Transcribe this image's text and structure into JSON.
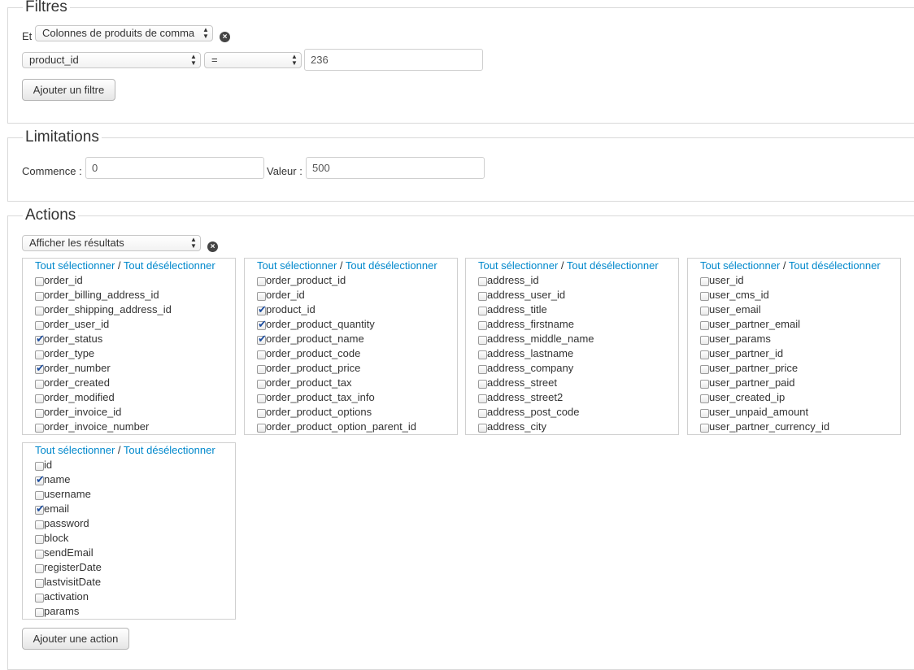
{
  "filters": {
    "legend": "Filtres",
    "and_label": "Et",
    "column_select": "Colonnes de produits de comma",
    "field_select": "product_id",
    "operator_select": "=",
    "value": "236",
    "add_button": "Ajouter un filtre"
  },
  "limits": {
    "legend": "Limitations",
    "start_label": "Commence :",
    "start_value": "0",
    "value_label": "Valeur :",
    "value_value": "500"
  },
  "actions": {
    "legend": "Actions",
    "action_select": "Afficher les résultats",
    "select_all": "Tout sélectionner",
    "separator": "/",
    "deselect_all": "Tout désélectionner",
    "add_button": "Ajouter une action",
    "boxes": [
      {
        "items": [
          {
            "label": "order_id",
            "checked": false
          },
          {
            "label": "order_billing_address_id",
            "checked": false
          },
          {
            "label": "order_shipping_address_id",
            "checked": false
          },
          {
            "label": "order_user_id",
            "checked": false
          },
          {
            "label": "order_status",
            "checked": true
          },
          {
            "label": "order_type",
            "checked": false
          },
          {
            "label": "order_number",
            "checked": true
          },
          {
            "label": "order_created",
            "checked": false
          },
          {
            "label": "order_modified",
            "checked": false
          },
          {
            "label": "order_invoice_id",
            "checked": false
          },
          {
            "label": "order_invoice_number",
            "checked": false
          }
        ]
      },
      {
        "items": [
          {
            "label": "order_product_id",
            "checked": false
          },
          {
            "label": "order_id",
            "checked": false
          },
          {
            "label": "product_id",
            "checked": true
          },
          {
            "label": "order_product_quantity",
            "checked": true
          },
          {
            "label": "order_product_name",
            "checked": true
          },
          {
            "label": "order_product_code",
            "checked": false
          },
          {
            "label": "order_product_price",
            "checked": false
          },
          {
            "label": "order_product_tax",
            "checked": false
          },
          {
            "label": "order_product_tax_info",
            "checked": false
          },
          {
            "label": "order_product_options",
            "checked": false
          },
          {
            "label": "order_product_option_parent_id",
            "checked": false
          }
        ]
      },
      {
        "items": [
          {
            "label": "address_id",
            "checked": false
          },
          {
            "label": "address_user_id",
            "checked": false
          },
          {
            "label": "address_title",
            "checked": false
          },
          {
            "label": "address_firstname",
            "checked": false
          },
          {
            "label": "address_middle_name",
            "checked": false
          },
          {
            "label": "address_lastname",
            "checked": false
          },
          {
            "label": "address_company",
            "checked": false
          },
          {
            "label": "address_street",
            "checked": false
          },
          {
            "label": "address_street2",
            "checked": false
          },
          {
            "label": "address_post_code",
            "checked": false
          },
          {
            "label": "address_city",
            "checked": false
          }
        ]
      },
      {
        "items": [
          {
            "label": "user_id",
            "checked": false
          },
          {
            "label": "user_cms_id",
            "checked": false
          },
          {
            "label": "user_email",
            "checked": false
          },
          {
            "label": "user_partner_email",
            "checked": false
          },
          {
            "label": "user_params",
            "checked": false
          },
          {
            "label": "user_partner_id",
            "checked": false
          },
          {
            "label": "user_partner_price",
            "checked": false
          },
          {
            "label": "user_partner_paid",
            "checked": false
          },
          {
            "label": "user_created_ip",
            "checked": false
          },
          {
            "label": "user_unpaid_amount",
            "checked": false
          },
          {
            "label": "user_partner_currency_id",
            "checked": false
          }
        ]
      },
      {
        "items": [
          {
            "label": "id",
            "checked": false
          },
          {
            "label": "name",
            "checked": true
          },
          {
            "label": "username",
            "checked": false
          },
          {
            "label": "email",
            "checked": true
          },
          {
            "label": "password",
            "checked": false
          },
          {
            "label": "block",
            "checked": false
          },
          {
            "label": "sendEmail",
            "checked": false
          },
          {
            "label": "registerDate",
            "checked": false
          },
          {
            "label": "lastvisitDate",
            "checked": false
          },
          {
            "label": "activation",
            "checked": false
          },
          {
            "label": "params",
            "checked": false
          }
        ]
      }
    ]
  }
}
